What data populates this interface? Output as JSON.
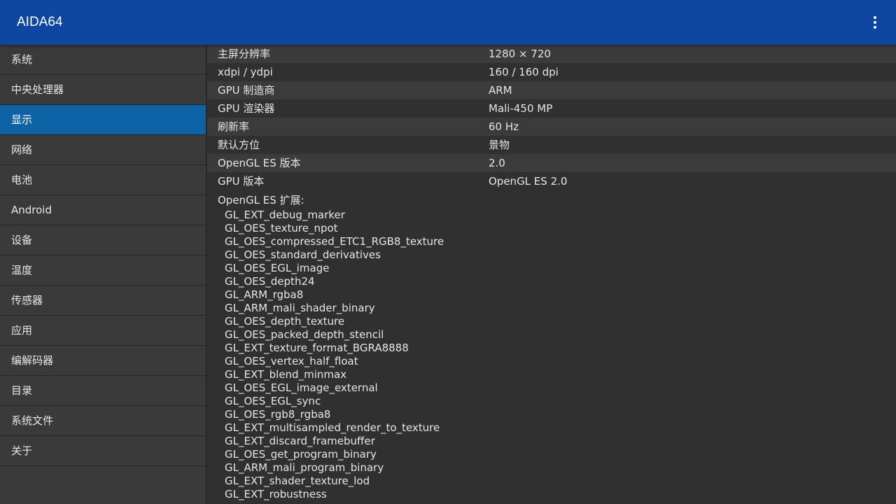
{
  "app": {
    "title": "AIDA64",
    "menu_icon": "more-vert-icon"
  },
  "sidebar": {
    "selected_index": 2,
    "items": [
      {
        "label": "系统"
      },
      {
        "label": "中央处理器"
      },
      {
        "label": "显示"
      },
      {
        "label": "网络"
      },
      {
        "label": "电池"
      },
      {
        "label": "Android"
      },
      {
        "label": "设备"
      },
      {
        "label": "温度"
      },
      {
        "label": "传感器"
      },
      {
        "label": "应用"
      },
      {
        "label": "编解码器"
      },
      {
        "label": "目录"
      },
      {
        "label": "系统文件"
      },
      {
        "label": "关于"
      }
    ]
  },
  "display": {
    "rows": [
      {
        "label": "主屏分辨率",
        "value": "1280 × 720"
      },
      {
        "label": "xdpi / ydpi",
        "value": "160 / 160 dpi"
      },
      {
        "label": "GPU 制造商",
        "value": "ARM"
      },
      {
        "label": "GPU 渲染器",
        "value": "Mali-450 MP"
      },
      {
        "label": "刷新率",
        "value": "60 Hz"
      },
      {
        "label": "默认方位",
        "value": "景物"
      },
      {
        "label": "OpenGL ES 版本",
        "value": "2.0"
      },
      {
        "label": "GPU 版本",
        "value": "OpenGL ES 2.0"
      }
    ],
    "extensions_label": "OpenGL ES 扩展:",
    "extensions": [
      "GL_EXT_debug_marker",
      "GL_OES_texture_npot",
      "GL_OES_compressed_ETC1_RGB8_texture",
      "GL_OES_standard_derivatives",
      "GL_OES_EGL_image",
      "GL_OES_depth24",
      "GL_ARM_rgba8",
      "GL_ARM_mali_shader_binary",
      "GL_OES_depth_texture",
      "GL_OES_packed_depth_stencil",
      "GL_EXT_texture_format_BGRA8888",
      "GL_OES_vertex_half_float",
      "GL_EXT_blend_minmax",
      "GL_OES_EGL_image_external",
      "GL_OES_EGL_sync",
      "GL_OES_rgb8_rgba8",
      "GL_EXT_multisampled_render_to_texture",
      "GL_EXT_discard_framebuffer",
      "GL_OES_get_program_binary",
      "GL_ARM_mali_program_binary",
      "GL_EXT_shader_texture_lod",
      "GL_EXT_robustness"
    ]
  },
  "colors": {
    "appbar": "#0d47a1",
    "selected": "#0d63a6",
    "background": "#303030"
  }
}
